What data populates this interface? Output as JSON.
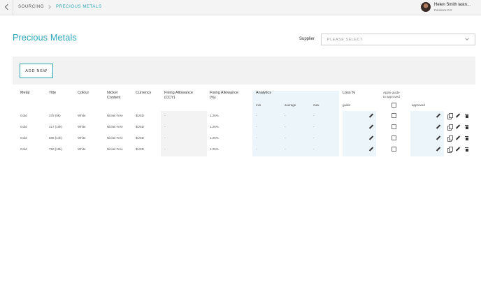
{
  "breadcrumb": {
    "root": "SOURCING",
    "current": "PRECIOUS METALS"
  },
  "user": {
    "name": "Helen Smith lastn...",
    "org": "Pandora KI4"
  },
  "page": {
    "title": "Precious Metals"
  },
  "supplier": {
    "label": "Supplier",
    "placeholder": "PLEASE SELECT"
  },
  "toolbar": {
    "add_label": "ADD NEW"
  },
  "table": {
    "headers": {
      "metal": "Metal",
      "title": "Title",
      "colour": "Colour",
      "nickel_1": "Nickel",
      "nickel_2": "Content",
      "currency": "Currency",
      "fix_ccy_1": "Fixing Allowance",
      "fix_ccy_2": "(CCY)",
      "fix_pct_1": "Fixing Allowance",
      "fix_pct_2": "(%)",
      "analytics": "Analytics",
      "loss": "Loss %",
      "apply_1": "Apply guide",
      "apply_2": "to approved"
    },
    "subheaders": {
      "min": "min",
      "average": "average",
      "max": "max",
      "guide": "guide",
      "approved": "approved"
    },
    "rows": [
      {
        "metal": "Gold",
        "title": "375 (9k)",
        "colour": "White",
        "nickel": "Nickel Free",
        "currency": "$USD",
        "fix_ccy": "-",
        "fix_pct": "1.25%",
        "min": "-",
        "average": "-",
        "max": "-"
      },
      {
        "metal": "Gold",
        "title": "417 (10k)",
        "colour": "White",
        "nickel": "Nickel Free",
        "currency": "$USD",
        "fix_ccy": "-",
        "fix_pct": "1.25%",
        "min": "-",
        "average": "-",
        "max": "-"
      },
      {
        "metal": "Gold",
        "title": "585 (14k)",
        "colour": "White",
        "nickel": "Nickel Free",
        "currency": "$USD",
        "fix_ccy": "-",
        "fix_pct": "1.25%",
        "min": "-",
        "average": "-",
        "max": "-"
      },
      {
        "metal": "Gold",
        "title": "750 (18k)",
        "colour": "White",
        "nickel": "Nickel Free",
        "currency": "$USD",
        "fix_ccy": "-",
        "fix_pct": "1.25%",
        "min": "-",
        "average": "-",
        "max": "-"
      }
    ]
  },
  "colors": {
    "accent": "#2aa7b8",
    "shade_grey": "#f3f3f3",
    "shade_blue": "#ecf5f9"
  },
  "icons": [
    "chevron-left-icon",
    "chevron-right-icon",
    "chevron-down-icon",
    "pencil-icon",
    "copy-icon",
    "trash-icon"
  ]
}
